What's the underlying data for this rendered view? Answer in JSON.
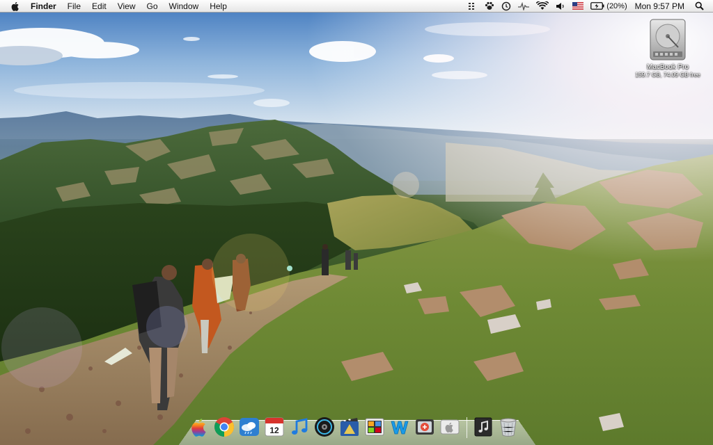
{
  "menubar": {
    "app_name": "Finder",
    "menus": [
      "File",
      "Edit",
      "View",
      "Go",
      "Window",
      "Help"
    ],
    "battery_percent": "(20%)",
    "clock": "Mon 9:57 PM"
  },
  "desktop": {
    "drive_name": "MacBook Pro",
    "drive_info": "159.7 GB, 74.09 GB free"
  },
  "dock": {
    "apps": [
      "finder-icon",
      "chrome-icon",
      "weather-icon",
      "calendar-icon",
      "itunes-icon",
      "dvd-player-icon",
      "imovie-icon",
      "photo-booth-icon",
      "w-app-icon",
      "tweetdeck-icon",
      "apple-app-icon"
    ],
    "calendar_day": "12",
    "stacks": [
      "music-stack-icon",
      "trash-icon"
    ]
  }
}
